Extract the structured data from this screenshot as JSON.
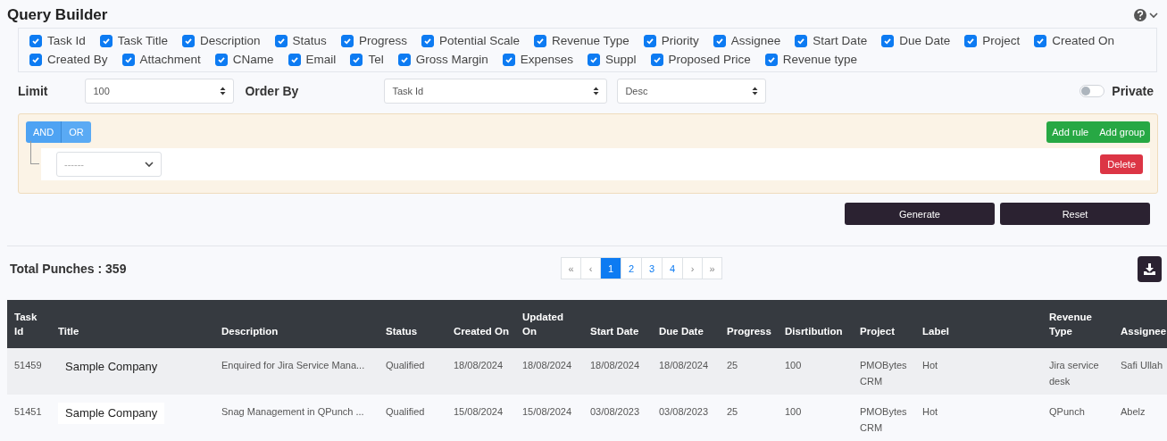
{
  "title": "Query Builder",
  "columns_picker": [
    {
      "label": "Task Id",
      "checked": true
    },
    {
      "label": "Task Title",
      "checked": true
    },
    {
      "label": "Description",
      "checked": true
    },
    {
      "label": "Status",
      "checked": true
    },
    {
      "label": "Progress",
      "checked": true
    },
    {
      "label": "Potential Scale",
      "checked": true
    },
    {
      "label": "Revenue Type",
      "checked": true
    },
    {
      "label": "Priority",
      "checked": true
    },
    {
      "label": "Assignee",
      "checked": true
    },
    {
      "label": "Start Date",
      "checked": true
    },
    {
      "label": "Due Date",
      "checked": true
    },
    {
      "label": "Project",
      "checked": true
    },
    {
      "label": "Created On",
      "checked": true
    },
    {
      "label": "Created By",
      "checked": true
    },
    {
      "label": "Attachment",
      "checked": true
    },
    {
      "label": "CName",
      "checked": true
    },
    {
      "label": "Email",
      "checked": true
    },
    {
      "label": "Tel",
      "checked": true
    },
    {
      "label": "Gross Margin",
      "checked": true
    },
    {
      "label": "Expenses",
      "checked": true
    },
    {
      "label": "Suppl",
      "checked": true
    },
    {
      "label": "Proposed Price",
      "checked": true
    },
    {
      "label": "Revenue type",
      "checked": true
    }
  ],
  "limit": {
    "label": "Limit",
    "value": "100"
  },
  "order_by": {
    "label": "Order By",
    "field": "Task Id",
    "direction": "Desc"
  },
  "private": {
    "label": "Private",
    "on": false
  },
  "rule_group": {
    "combinators": [
      {
        "label": "AND",
        "selected": true
      },
      {
        "label": "OR",
        "selected": false
      }
    ],
    "buttons": [
      "Add rule",
      "Add group"
    ],
    "rule": {
      "field": "------",
      "delete": "Delete"
    }
  },
  "actions": [
    "Generate",
    "Reset"
  ],
  "total": "Total Punches : 359",
  "pagination": [
    {
      "label": "«",
      "selected": false
    },
    {
      "label": "‹",
      "selected": false
    },
    {
      "label": "1",
      "selected": true
    },
    {
      "label": "2",
      "selected": false
    },
    {
      "label": "3",
      "selected": false
    },
    {
      "label": "4",
      "selected": false
    },
    {
      "label": "›",
      "selected": false
    },
    {
      "label": "»",
      "selected": false
    }
  ],
  "table": {
    "columns": [
      "Task Id",
      "Title",
      "Description",
      "Status",
      "Created On",
      "Updated On",
      "Start Date",
      "Due Date",
      "Progress",
      "Disrtibution",
      "Project",
      "Label",
      "Revenue Type",
      "Assignee"
    ],
    "rows": [
      [
        "51459",
        "Sample Company",
        "Enquired for Jira Service Mana...",
        "Qualified",
        "18/08/2024",
        "18/08/2024",
        "18/08/2024",
        "18/08/2024",
        "25",
        "100",
        "PMOBytes CRM",
        "Hot",
        "Jira service desk",
        "Safi Ullah"
      ],
      [
        "51451",
        "Sample Company",
        "Snag Management in QPunch ...",
        "Qualified",
        "15/08/2024",
        "15/08/2024",
        "03/08/2023",
        "03/08/2023",
        "25",
        "100",
        "PMOBytes CRM",
        "Hot",
        "QPunch",
        "Abelz"
      ]
    ]
  }
}
